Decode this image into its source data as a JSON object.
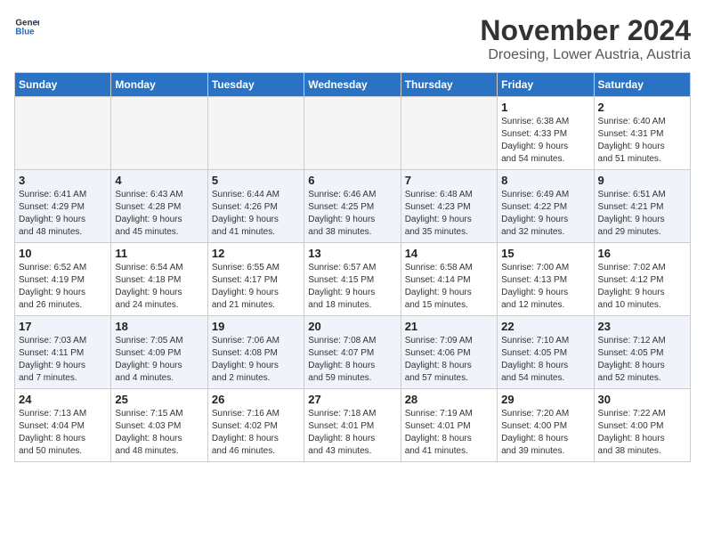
{
  "header": {
    "logo_general": "General",
    "logo_blue": "Blue",
    "month_year": "November 2024",
    "location": "Droesing, Lower Austria, Austria"
  },
  "days_of_week": [
    "Sunday",
    "Monday",
    "Tuesday",
    "Wednesday",
    "Thursday",
    "Friday",
    "Saturday"
  ],
  "weeks": [
    [
      {
        "day": "",
        "info": ""
      },
      {
        "day": "",
        "info": ""
      },
      {
        "day": "",
        "info": ""
      },
      {
        "day": "",
        "info": ""
      },
      {
        "day": "",
        "info": ""
      },
      {
        "day": "1",
        "info": "Sunrise: 6:38 AM\nSunset: 4:33 PM\nDaylight: 9 hours\nand 54 minutes."
      },
      {
        "day": "2",
        "info": "Sunrise: 6:40 AM\nSunset: 4:31 PM\nDaylight: 9 hours\nand 51 minutes."
      }
    ],
    [
      {
        "day": "3",
        "info": "Sunrise: 6:41 AM\nSunset: 4:29 PM\nDaylight: 9 hours\nand 48 minutes."
      },
      {
        "day": "4",
        "info": "Sunrise: 6:43 AM\nSunset: 4:28 PM\nDaylight: 9 hours\nand 45 minutes."
      },
      {
        "day": "5",
        "info": "Sunrise: 6:44 AM\nSunset: 4:26 PM\nDaylight: 9 hours\nand 41 minutes."
      },
      {
        "day": "6",
        "info": "Sunrise: 6:46 AM\nSunset: 4:25 PM\nDaylight: 9 hours\nand 38 minutes."
      },
      {
        "day": "7",
        "info": "Sunrise: 6:48 AM\nSunset: 4:23 PM\nDaylight: 9 hours\nand 35 minutes."
      },
      {
        "day": "8",
        "info": "Sunrise: 6:49 AM\nSunset: 4:22 PM\nDaylight: 9 hours\nand 32 minutes."
      },
      {
        "day": "9",
        "info": "Sunrise: 6:51 AM\nSunset: 4:21 PM\nDaylight: 9 hours\nand 29 minutes."
      }
    ],
    [
      {
        "day": "10",
        "info": "Sunrise: 6:52 AM\nSunset: 4:19 PM\nDaylight: 9 hours\nand 26 minutes."
      },
      {
        "day": "11",
        "info": "Sunrise: 6:54 AM\nSunset: 4:18 PM\nDaylight: 9 hours\nand 24 minutes."
      },
      {
        "day": "12",
        "info": "Sunrise: 6:55 AM\nSunset: 4:17 PM\nDaylight: 9 hours\nand 21 minutes."
      },
      {
        "day": "13",
        "info": "Sunrise: 6:57 AM\nSunset: 4:15 PM\nDaylight: 9 hours\nand 18 minutes."
      },
      {
        "day": "14",
        "info": "Sunrise: 6:58 AM\nSunset: 4:14 PM\nDaylight: 9 hours\nand 15 minutes."
      },
      {
        "day": "15",
        "info": "Sunrise: 7:00 AM\nSunset: 4:13 PM\nDaylight: 9 hours\nand 12 minutes."
      },
      {
        "day": "16",
        "info": "Sunrise: 7:02 AM\nSunset: 4:12 PM\nDaylight: 9 hours\nand 10 minutes."
      }
    ],
    [
      {
        "day": "17",
        "info": "Sunrise: 7:03 AM\nSunset: 4:11 PM\nDaylight: 9 hours\nand 7 minutes."
      },
      {
        "day": "18",
        "info": "Sunrise: 7:05 AM\nSunset: 4:09 PM\nDaylight: 9 hours\nand 4 minutes."
      },
      {
        "day": "19",
        "info": "Sunrise: 7:06 AM\nSunset: 4:08 PM\nDaylight: 9 hours\nand 2 minutes."
      },
      {
        "day": "20",
        "info": "Sunrise: 7:08 AM\nSunset: 4:07 PM\nDaylight: 8 hours\nand 59 minutes."
      },
      {
        "day": "21",
        "info": "Sunrise: 7:09 AM\nSunset: 4:06 PM\nDaylight: 8 hours\nand 57 minutes."
      },
      {
        "day": "22",
        "info": "Sunrise: 7:10 AM\nSunset: 4:05 PM\nDaylight: 8 hours\nand 54 minutes."
      },
      {
        "day": "23",
        "info": "Sunrise: 7:12 AM\nSunset: 4:05 PM\nDaylight: 8 hours\nand 52 minutes."
      }
    ],
    [
      {
        "day": "24",
        "info": "Sunrise: 7:13 AM\nSunset: 4:04 PM\nDaylight: 8 hours\nand 50 minutes."
      },
      {
        "day": "25",
        "info": "Sunrise: 7:15 AM\nSunset: 4:03 PM\nDaylight: 8 hours\nand 48 minutes."
      },
      {
        "day": "26",
        "info": "Sunrise: 7:16 AM\nSunset: 4:02 PM\nDaylight: 8 hours\nand 46 minutes."
      },
      {
        "day": "27",
        "info": "Sunrise: 7:18 AM\nSunset: 4:01 PM\nDaylight: 8 hours\nand 43 minutes."
      },
      {
        "day": "28",
        "info": "Sunrise: 7:19 AM\nSunset: 4:01 PM\nDaylight: 8 hours\nand 41 minutes."
      },
      {
        "day": "29",
        "info": "Sunrise: 7:20 AM\nSunset: 4:00 PM\nDaylight: 8 hours\nand 39 minutes."
      },
      {
        "day": "30",
        "info": "Sunrise: 7:22 AM\nSunset: 4:00 PM\nDaylight: 8 hours\nand 38 minutes."
      }
    ]
  ]
}
